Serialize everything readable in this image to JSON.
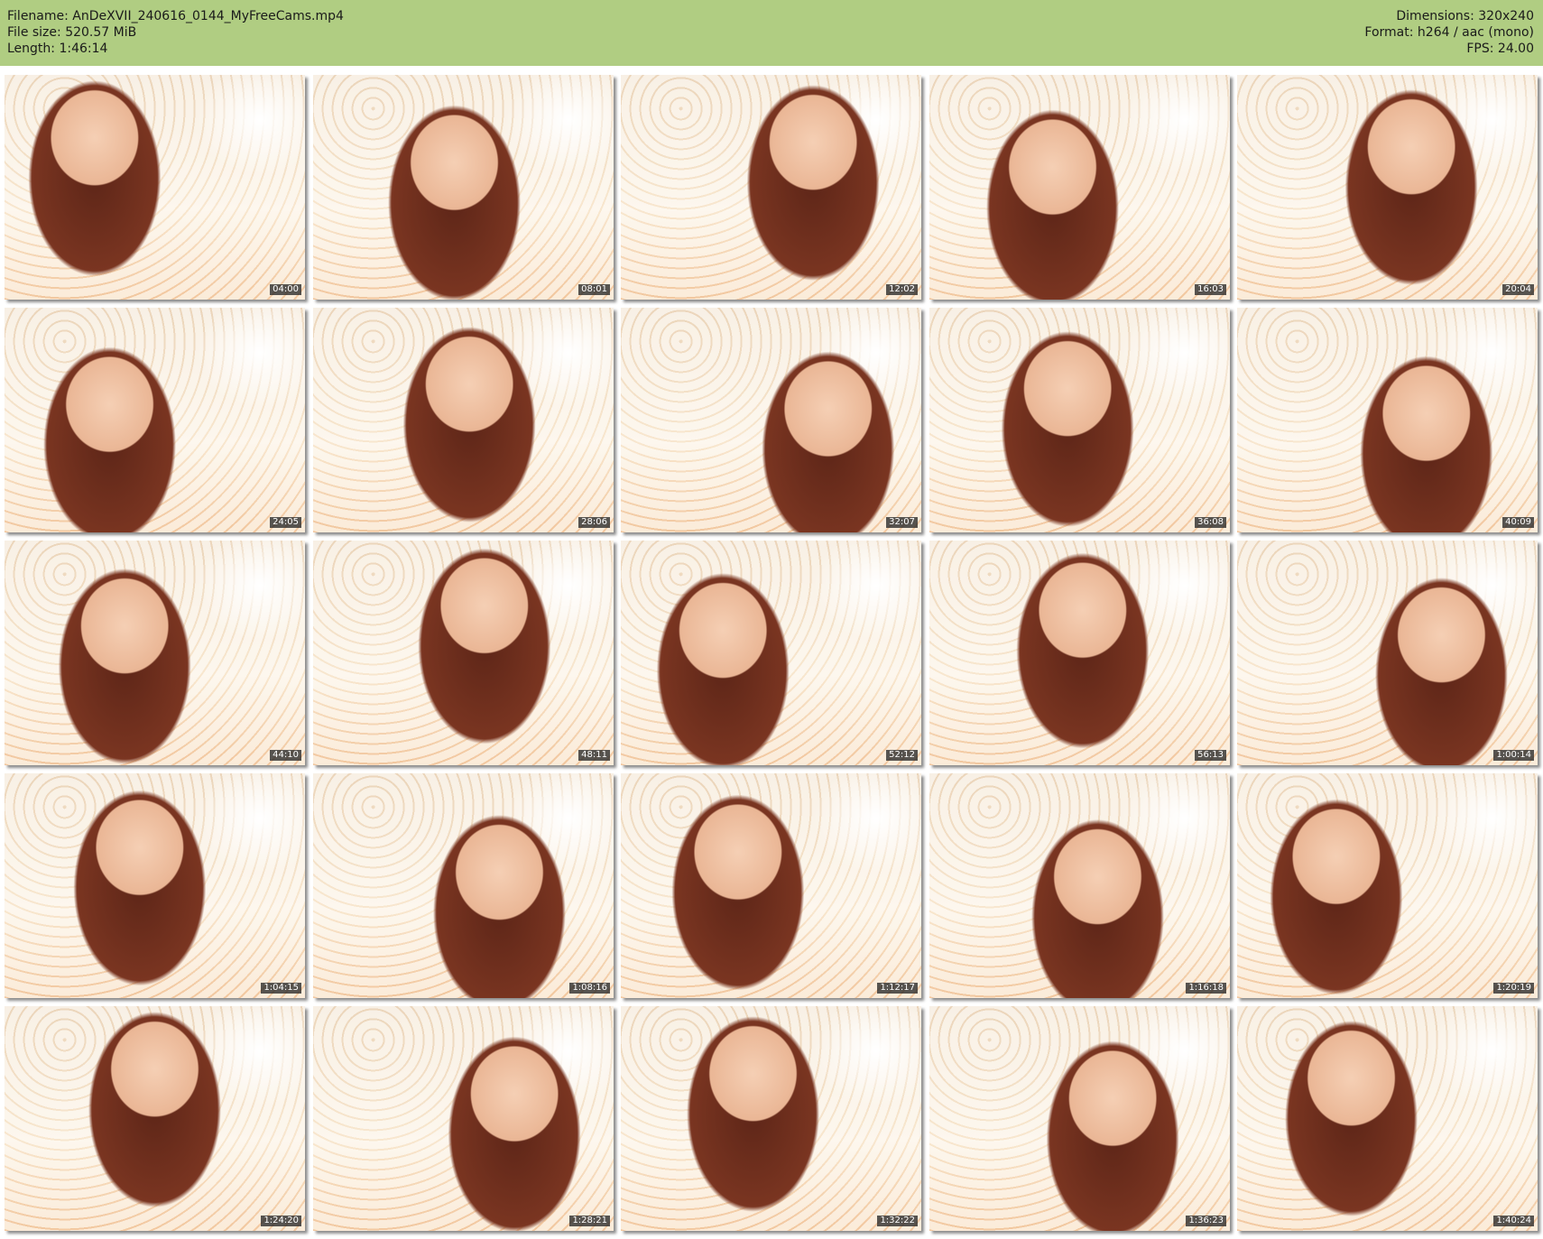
{
  "header": {
    "filename": "Filename: AnDeXVII_240616_0144_MyFreeCams.mp4",
    "filesize": "File size: 520.57 MiB",
    "length": "Length: 1:46:14",
    "dimensions": "Dimensions: 320x240",
    "format": "Format: h264 / aac (mono)",
    "fps": "FPS: 24.00"
  },
  "colors": {
    "header_bg": "#b0cd82",
    "timestamp_bg": "#3a3a3a"
  },
  "thumbnails": [
    {
      "time": "04:00"
    },
    {
      "time": "08:01"
    },
    {
      "time": "12:02"
    },
    {
      "time": "16:03"
    },
    {
      "time": "20:04"
    },
    {
      "time": "24:05"
    },
    {
      "time": "28:06"
    },
    {
      "time": "32:07"
    },
    {
      "time": "36:08"
    },
    {
      "time": "40:09"
    },
    {
      "time": "44:10"
    },
    {
      "time": "48:11"
    },
    {
      "time": "52:12"
    },
    {
      "time": "56:13"
    },
    {
      "time": "1:00:14"
    },
    {
      "time": "1:04:15"
    },
    {
      "time": "1:08:16"
    },
    {
      "time": "1:12:17"
    },
    {
      "time": "1:16:18"
    },
    {
      "time": "1:20:19"
    },
    {
      "time": "1:24:20"
    },
    {
      "time": "1:28:21"
    },
    {
      "time": "1:32:22"
    },
    {
      "time": "1:36:23"
    },
    {
      "time": "1:40:24"
    }
  ]
}
